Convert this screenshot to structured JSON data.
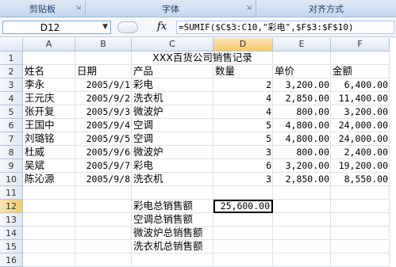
{
  "ribbon": {
    "groups": [
      "剪贴板",
      "字体",
      "对齐方式"
    ]
  },
  "formula_bar": {
    "name_box": "D12",
    "fx": "fx",
    "formula": "=SUMIF($C$3:C10,\"彩电\",$F$3:$F$10)"
  },
  "columns": [
    "A",
    "B",
    "C",
    "D",
    "E",
    "F"
  ],
  "rows": [
    "1",
    "2",
    "3",
    "4",
    "5",
    "6",
    "7",
    "8",
    "9",
    "10",
    "11",
    "12",
    "13",
    "14",
    "15",
    "16"
  ],
  "active_cell": "D12",
  "sheet": {
    "title": "XXX百货公司销售记录",
    "headers": [
      "姓名",
      "日期",
      "产品",
      "数量",
      "单价",
      "金额"
    ],
    "records": [
      [
        "李永",
        "2005/9/1",
        "彩电",
        "2",
        "3,200.00",
        "6,400.00"
      ],
      [
        "王元庆",
        "2005/9/2",
        "洗衣机",
        "4",
        "2,850.00",
        "11,400.00"
      ],
      [
        "张开复",
        "2005/9/3",
        "微波炉",
        "4",
        "800.00",
        "3,200.00"
      ],
      [
        "王国中",
        "2005/9/4",
        "空调",
        "5",
        "4,800.00",
        "24,000.00"
      ],
      [
        "刘璐铭",
        "2005/9/5",
        "空调",
        "5",
        "4,800.00",
        "24,000.00"
      ],
      [
        "杜威",
        "2005/9/6",
        "微波炉",
        "3",
        "800.00",
        "2,400.00"
      ],
      [
        "吴斌",
        "2005/9/7",
        "彩电",
        "6",
        "3,200.00",
        "19,200.00"
      ],
      [
        "陈沁源",
        "2005/9/8",
        "洗衣机",
        "3",
        "2,850.00",
        "8,550.00"
      ]
    ],
    "summary": [
      {
        "label": "彩电总销售额",
        "value": "25,600.00"
      },
      {
        "label": "空调总销售额",
        "value": ""
      },
      {
        "label": "微波炉总销售额",
        "value": ""
      },
      {
        "label": "洗衣机总销售额",
        "value": ""
      }
    ]
  }
}
